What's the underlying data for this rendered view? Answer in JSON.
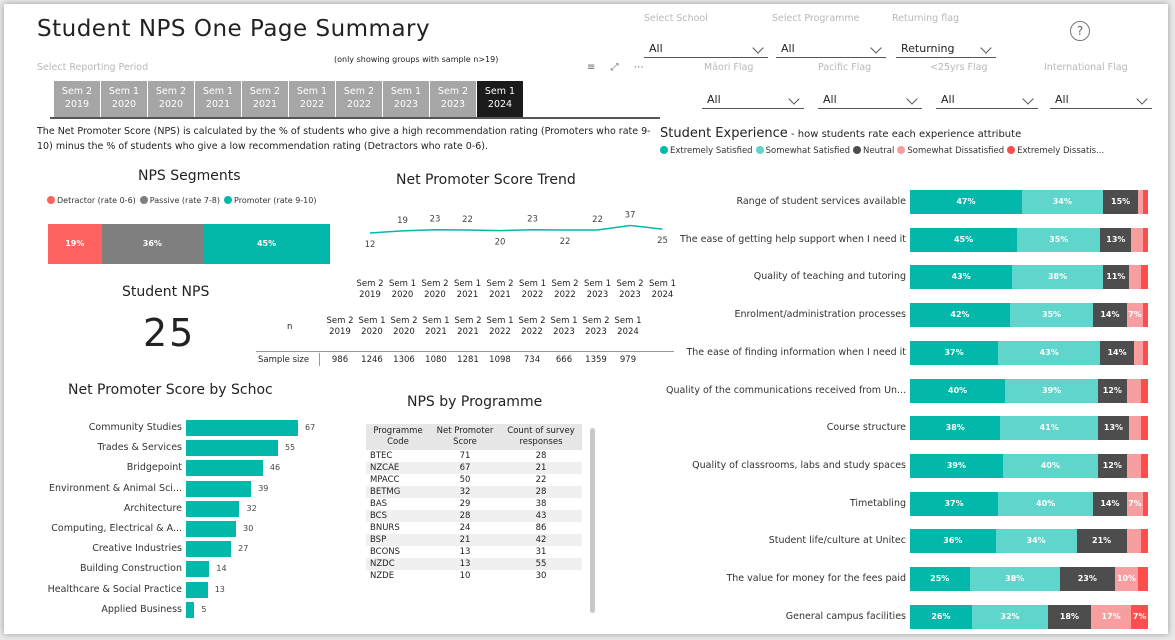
{
  "header": {
    "title": "Student NPS One Page Summary",
    "sample_note": "(only showing groups with sample n>19)",
    "reporting_period_label": "Select Reporting Period"
  },
  "filters": {
    "school": {
      "label": "Select School",
      "value": "All"
    },
    "programme": {
      "label": "Select Programme",
      "value": "All"
    },
    "returning": {
      "label": "Returning flag",
      "value": "Returning"
    },
    "maori": {
      "label": "Māori Flag",
      "value": "All"
    },
    "pacific": {
      "label": "Pacific Flag",
      "value": "All"
    },
    "under25": {
      "label": "<25yrs Flag",
      "value": "All"
    },
    "international": {
      "label": "International Flag",
      "value": "All"
    }
  },
  "help_icon": "question-circle-icon",
  "periods": [
    {
      "l1": "Sem 2",
      "l2": "2019"
    },
    {
      "l1": "Sem 1",
      "l2": "2020"
    },
    {
      "l1": "Sem 2",
      "l2": "2020"
    },
    {
      "l1": "Sem 1",
      "l2": "2021"
    },
    {
      "l1": "Sem 2",
      "l2": "2021"
    },
    {
      "l1": "Sem 1",
      "l2": "2022"
    },
    {
      "l1": "Sem 2",
      "l2": "2022"
    },
    {
      "l1": "Sem 1",
      "l2": "2023"
    },
    {
      "l1": "Sem 2",
      "l2": "2023"
    },
    {
      "l1": "Sem 1",
      "l2": "2024"
    }
  ],
  "selected_period_index": 9,
  "description": "The Net Promoter Score (NPS) is calculated by the % of students who give a high recommendation rating (Promoters who rate 9-10) minus the % of students who give a low recommendation rating (Detractors who rate 0-6).",
  "segments": {
    "title": "NPS Segments",
    "legend": [
      {
        "label": "Detractor (rate 0-6)",
        "color": "#fd625e"
      },
      {
        "label": "Passive (rate 7-8)",
        "color": "#7f7f7f"
      },
      {
        "label": "Promoter (rate 9-10)",
        "color": "#01b8aa"
      }
    ],
    "values": [
      {
        "label": "19%",
        "pct": 19,
        "color": "#fd625e"
      },
      {
        "label": "36%",
        "pct": 36,
        "color": "#7f7f7f"
      },
      {
        "label": "45%",
        "pct": 45,
        "color": "#01b8aa"
      }
    ]
  },
  "student_nps": {
    "title": "Student NPS",
    "value": "25"
  },
  "trend": {
    "title": "Net Promoter Score Trend",
    "values": [
      12,
      19,
      23,
      22,
      20,
      23,
      22,
      22,
      37,
      25
    ],
    "labels": [
      "12",
      "19",
      "23",
      "22",
      "20",
      "23",
      "22",
      "22",
      "37",
      "25"
    ],
    "color": "#01b8aa"
  },
  "sample_table": {
    "n_label": "n",
    "row_label": "Sample size",
    "values": [
      "986",
      "1246",
      "1306",
      "1080",
      "1281",
      "1098",
      "734",
      "666",
      "1359",
      "979"
    ]
  },
  "schools": {
    "title": "Net Promoter Score by Schoc",
    "items": [
      {
        "name": "Community Studies",
        "value": 67
      },
      {
        "name": "Trades & Services",
        "value": 55
      },
      {
        "name": "Bridgepoint",
        "value": 46
      },
      {
        "name": "Environment & Animal Sci...",
        "value": 39
      },
      {
        "name": "Architecture",
        "value": 32
      },
      {
        "name": "Computing, Electrical & A...",
        "value": 30
      },
      {
        "name": "Creative Industries",
        "value": 27
      },
      {
        "name": "Building Construction",
        "value": 14
      },
      {
        "name": "Healthcare & Social Practice",
        "value": 13
      },
      {
        "name": "Applied Business",
        "value": 5
      }
    ]
  },
  "programmes": {
    "title": "NPS by Programme",
    "headers": [
      "Programme Code",
      "Net Promoter Score",
      "Count of survey responses"
    ],
    "rows": [
      [
        "BTEC",
        "71",
        "28"
      ],
      [
        "NZCAE",
        "67",
        "21"
      ],
      [
        "MPACC",
        "50",
        "22"
      ],
      [
        "BETMG",
        "32",
        "28"
      ],
      [
        "BAS",
        "29",
        "38"
      ],
      [
        "BCS",
        "28",
        "43"
      ],
      [
        "BNURS",
        "24",
        "86"
      ],
      [
        "BSP",
        "21",
        "42"
      ],
      [
        "BCONS",
        "13",
        "31"
      ],
      [
        "NZDC",
        "13",
        "55"
      ],
      [
        "NZDE",
        "10",
        "30"
      ]
    ]
  },
  "experience": {
    "title": "Student Experience",
    "subtitle": " - how students rate each experience attribute",
    "legend": [
      {
        "label": "Extremely Satisfied",
        "color": "#01b8aa"
      },
      {
        "label": "Somewhat Satisfied",
        "color": "#5fd5cb"
      },
      {
        "label": "Neutral",
        "color": "#4d4d4d"
      },
      {
        "label": "Somewhat Dissatisfied",
        "color": "#f69ea0"
      },
      {
        "label": "Extremely Dissatis...",
        "color": "#fd4d4d"
      }
    ],
    "items": [
      {
        "name": "Range of student services available",
        "values": [
          47,
          34,
          15,
          2,
          2
        ],
        "labels": [
          "47%",
          "34%",
          "15%",
          "",
          ""
        ]
      },
      {
        "name": "The ease of getting help support when I need it",
        "values": [
          45,
          35,
          13,
          5,
          2
        ],
        "labels": [
          "45%",
          "35%",
          "13%",
          "",
          ""
        ]
      },
      {
        "name": "Quality of teaching and tutoring",
        "values": [
          43,
          38,
          11,
          5,
          3
        ],
        "labels": [
          "43%",
          "38%",
          "11%",
          "",
          ""
        ]
      },
      {
        "name": "Enrolment/administration processes",
        "values": [
          42,
          35,
          14,
          7,
          2
        ],
        "labels": [
          "42%",
          "35%",
          "14%",
          "7%",
          ""
        ]
      },
      {
        "name": "The ease of finding information when I need it",
        "values": [
          37,
          43,
          14,
          4,
          2
        ],
        "labels": [
          "37%",
          "43%",
          "14%",
          "",
          ""
        ]
      },
      {
        "name": "Quality of the communications received from Un...",
        "values": [
          40,
          39,
          12,
          6,
          3
        ],
        "labels": [
          "40%",
          "39%",
          "12%",
          "",
          ""
        ]
      },
      {
        "name": "Course structure",
        "values": [
          38,
          41,
          13,
          5,
          3
        ],
        "labels": [
          "38%",
          "41%",
          "13%",
          "",
          ""
        ]
      },
      {
        "name": "Quality of classrooms, labs and study spaces",
        "values": [
          39,
          40,
          12,
          6,
          3
        ],
        "labels": [
          "39%",
          "40%",
          "12%",
          "",
          ""
        ]
      },
      {
        "name": "Timetabling",
        "values": [
          37,
          40,
          14,
          7,
          2
        ],
        "labels": [
          "37%",
          "40%",
          "14%",
          "7%",
          ""
        ]
      },
      {
        "name": "Student life/culture at Unitec",
        "values": [
          36,
          34,
          21,
          6,
          3
        ],
        "labels": [
          "36%",
          "34%",
          "21%",
          "",
          ""
        ]
      },
      {
        "name": "The value for money for the fees paid",
        "values": [
          25,
          38,
          23,
          10,
          4
        ],
        "labels": [
          "25%",
          "38%",
          "23%",
          "10%",
          ""
        ]
      },
      {
        "name": "General campus facilities",
        "values": [
          26,
          32,
          18,
          17,
          7
        ],
        "labels": [
          "26%",
          "32%",
          "18%",
          "17%",
          "7%"
        ]
      }
    ]
  }
}
